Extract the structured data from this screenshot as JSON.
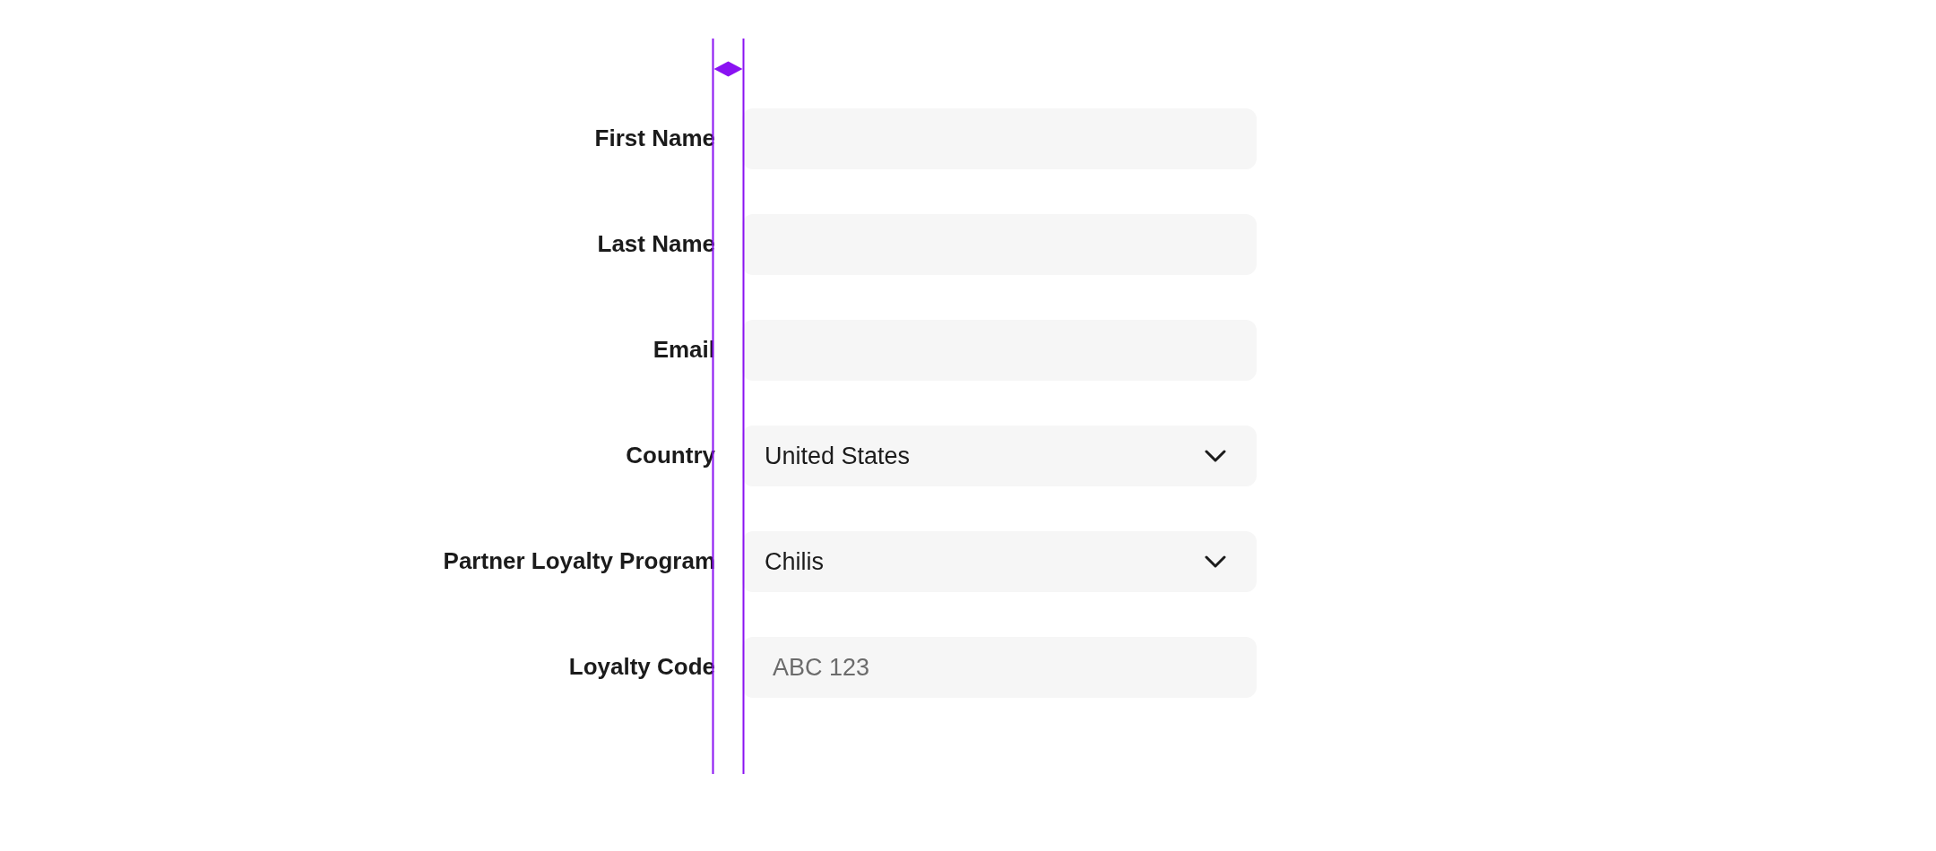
{
  "form": {
    "fields": [
      {
        "label": "First Name",
        "kind": "text"
      },
      {
        "label": "Last Name",
        "kind": "text"
      },
      {
        "label": "Email",
        "kind": "text"
      },
      {
        "label": "Country",
        "kind": "select",
        "value": "United States"
      },
      {
        "label": "Partner Loyalty Program",
        "kind": "select",
        "value": "Chilis"
      },
      {
        "label": "Loyalty Code",
        "kind": "text",
        "placeholder": "ABC 123"
      }
    ]
  }
}
